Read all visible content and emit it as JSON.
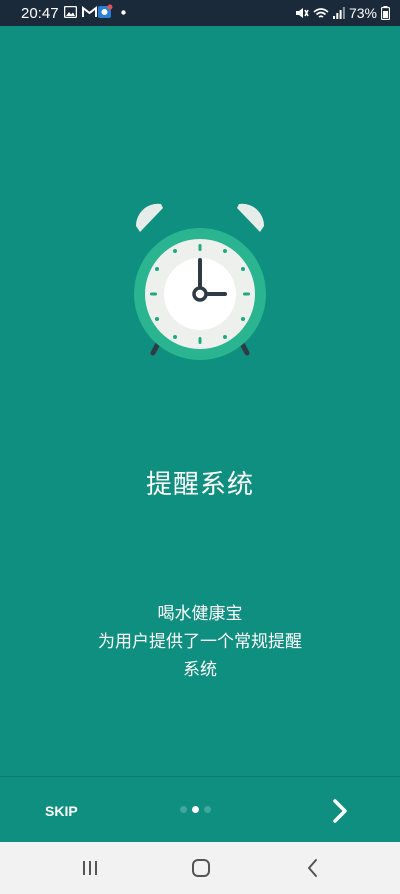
{
  "status_bar": {
    "time": "20:47",
    "battery_text": "73%",
    "left_icons": [
      "image-icon",
      "gmail-icon",
      "app-notification-icon",
      "dot-icon"
    ],
    "right_icons": [
      "mute-icon",
      "wifi-icon",
      "signal-icon",
      "battery-icon"
    ]
  },
  "onboarding": {
    "icon": "alarm-clock-icon",
    "title": "提醒系统",
    "description_lines": [
      "喝水健康宝",
      "为用户提供了一个常规提醒",
      "系统"
    ]
  },
  "footer": {
    "skip_label": "SKIP",
    "page_indicator": {
      "total": 3,
      "active": 2
    },
    "next_icon": "chevron-right-icon"
  },
  "system_nav": {
    "buttons": [
      "recents-icon",
      "home-icon",
      "back-icon"
    ]
  },
  "colors": {
    "background": "#0f8f7f",
    "status_bar": "#1b2a3a",
    "clock_ring": "#2ab48f",
    "clock_face": "#eef0ee",
    "clock_accent": "#1ea97f",
    "nav_bar": "#f2f2f2"
  }
}
